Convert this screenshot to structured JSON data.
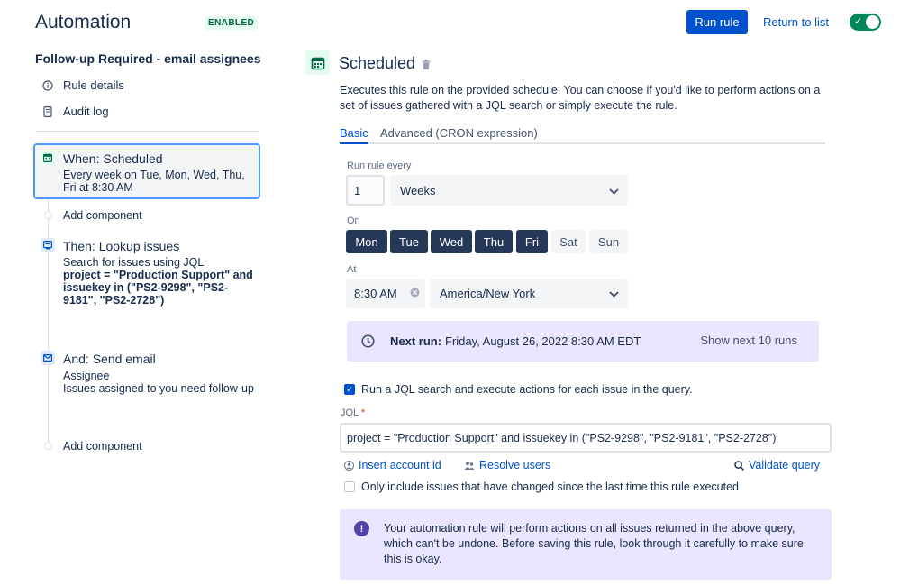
{
  "header": {
    "title": "Automation",
    "status_badge": "ENABLED",
    "run_rule": "Run rule",
    "return_to_list": "Return to list"
  },
  "sidebar": {
    "rule_name": "Follow-up Required - email assignees",
    "nav": [
      {
        "label": "Rule details",
        "icon": "info-icon"
      },
      {
        "label": "Audit log",
        "icon": "document-icon"
      }
    ],
    "steps": {
      "when": {
        "title": "When: Scheduled",
        "desc": "Every week on Tue, Mon, Wed, Thu, Fri at 8:30 AM",
        "icon": "calendar-icon"
      },
      "add1": "Add component",
      "then": {
        "title": "Then: Lookup issues",
        "desc": "Search for issues using JQL",
        "bold": "project = \"Production Support\" and issuekey in (\"PS2-9298\", \"PS2-9181\", \"PS2-2728\")",
        "icon": "lookup-icon"
      },
      "and": {
        "title": "And: Send email",
        "line1": "Assignee",
        "line2": "Issues assigned to you need follow-up",
        "icon": "email-icon"
      },
      "add2": "Add component"
    }
  },
  "main": {
    "title": "Scheduled",
    "description": "Executes this rule on the provided schedule. You can choose if you'd like to perform actions on a set of issues gathered with a JQL search or simply execute the rule.",
    "tabs": {
      "basic": "Basic",
      "advanced": "Advanced (CRON expression)"
    },
    "run_every_label": "Run rule every",
    "run_every_value": "1",
    "run_every_unit": "Weeks",
    "on_label": "On",
    "days": [
      {
        "label": "Mon",
        "selected": true
      },
      {
        "label": "Tue",
        "selected": true
      },
      {
        "label": "Wed",
        "selected": true
      },
      {
        "label": "Thu",
        "selected": true
      },
      {
        "label": "Fri",
        "selected": true
      },
      {
        "label": "Sat",
        "selected": false
      },
      {
        "label": "Sun",
        "selected": false
      }
    ],
    "at_label": "At",
    "time_value": "8:30 AM",
    "timezone": "America/New York",
    "next_run_label": "Next run:",
    "next_run_value": "Friday, August 26, 2022 8:30 AM EDT",
    "show_next": "Show next 10 runs",
    "jql_checkbox": "Run a JQL search and execute actions for each issue in the query.",
    "jql_label": "JQL",
    "jql_required": "*",
    "jql_value": "project = \"Production Support\" and issuekey in (\"PS2-9298\", \"PS2-9181\", \"PS2-2728\")",
    "insert_account": "Insert account id",
    "resolve_users": "Resolve users",
    "validate_query": "Validate query",
    "only_changed": "Only include issues that have changed since the last time this rule executed",
    "warning": "Your automation rule will perform actions on all issues returned in the above query, which can't be undone. Before saving this rule, look through it carefully to make sure this is okay."
  },
  "colors": {
    "primary": "#0052CC",
    "enabled": "#00875A",
    "selected_day": "#253858",
    "info_bg": "#EAE6FF"
  }
}
